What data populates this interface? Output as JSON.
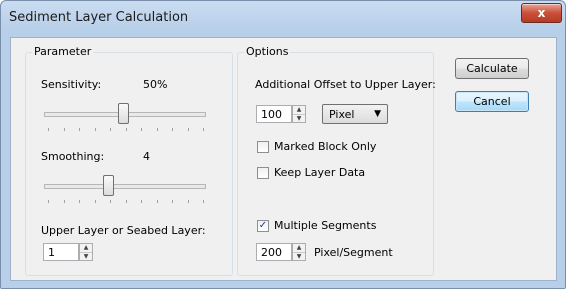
{
  "window": {
    "title": "Sediment Layer Calculation",
    "close_glyph": "x"
  },
  "parameter": {
    "group_label": "Parameter",
    "sensitivity": {
      "label": "Sensitivity:",
      "value_text": "50%",
      "level": 0.5
    },
    "smoothing": {
      "label": "Smoothing:",
      "value_text": "4",
      "level": 0.4
    },
    "upper_layer": {
      "label": "Upper Layer or Seabed Layer:",
      "value": "1"
    }
  },
  "options": {
    "group_label": "Options",
    "offset_label": "Additional Offset to Upper Layer:",
    "offset_value": "100",
    "unit_selected": "Pixel",
    "marked_block_only": {
      "label": "Marked Block Only",
      "checked": false
    },
    "keep_layer_data": {
      "label": "Keep Layer Data",
      "checked": false
    },
    "multiple_segments": {
      "label": "Multiple Segments",
      "checked": true
    },
    "segment_value": "200",
    "segment_unit": "Pixel/Segment"
  },
  "buttons": {
    "calculate": "Calculate",
    "cancel": "Cancel"
  },
  "icons": {
    "close": "close-icon",
    "spin_up": "chevron-up-icon",
    "spin_down": "chevron-down-icon",
    "dropdown": "chevron-down-icon",
    "check": "check-icon"
  }
}
